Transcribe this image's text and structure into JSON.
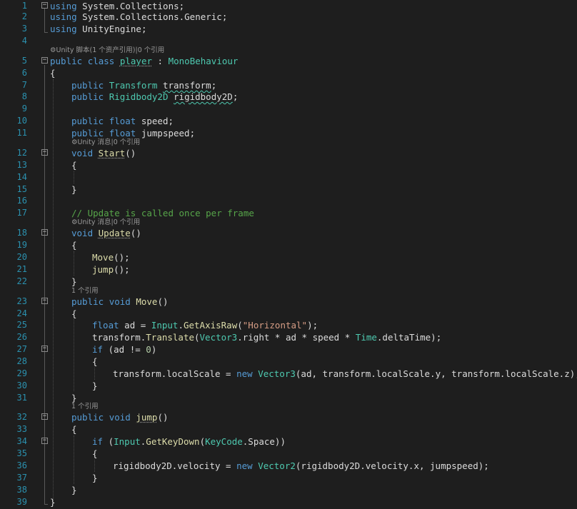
{
  "editor": {
    "line_numbers": [
      "1",
      "2",
      "3",
      "4",
      "5",
      "6",
      "7",
      "8",
      "9",
      "10",
      "11",
      "12",
      "13",
      "14",
      "15",
      "16",
      "17",
      "18",
      "19",
      "20",
      "21",
      "22",
      "23",
      "24",
      "25",
      "26",
      "27",
      "28",
      "29",
      "30",
      "31",
      "32",
      "33",
      "34",
      "35",
      "36",
      "37",
      "38",
      "39"
    ],
    "codelens": {
      "unity_script": "Unity 脚本(1 个资产引用)|0 个引用",
      "unity_message_start": "Unity 消息|0 个引用",
      "unity_message_update": "Unity 消息|0 个引用",
      "move_refs": "1 个引用",
      "jump_refs": "1 个引用"
    }
  },
  "code": {
    "l1": [
      "using",
      " System.Collections;"
    ],
    "l2": [
      "using",
      " System.Collections.Generic;"
    ],
    "l3": [
      "using",
      " UnityEngine;"
    ],
    "l5": [
      "public",
      " ",
      "class",
      " ",
      "player",
      " : ",
      "MonoBehaviour"
    ],
    "l6": [
      "{"
    ],
    "l7": [
      "public",
      " ",
      "Transform",
      " ",
      "transform",
      ";"
    ],
    "l8": [
      "public",
      " ",
      "Rigidbody2D",
      " ",
      "rigidbody2D",
      ";"
    ],
    "l10": [
      "public",
      " ",
      "float",
      " speed;"
    ],
    "l11": [
      "public",
      " ",
      "float",
      " jumpspeed;"
    ],
    "l12": [
      "void",
      " ",
      "Start",
      "()"
    ],
    "l13": [
      "{"
    ],
    "l15": [
      "}"
    ],
    "l17": [
      "// Update is called once per frame"
    ],
    "l18": [
      "void",
      " ",
      "Update",
      "()"
    ],
    "l19": [
      "{"
    ],
    "l20": [
      "Move",
      "();"
    ],
    "l21": [
      "jump",
      "();"
    ],
    "l22": [
      "}"
    ],
    "l23": [
      "public",
      " ",
      "void",
      " ",
      "Move",
      "()"
    ],
    "l24": [
      "{"
    ],
    "l25": [
      "float",
      " ad = ",
      "Input",
      ".",
      "GetAxisRaw",
      "(",
      "\"Horizontal\"",
      ");"
    ],
    "l26": [
      "transform",
      ".",
      "Translate",
      "(",
      "Vector3",
      ".right * ad * speed * ",
      "Time",
      ".deltaTime);"
    ],
    "l27": [
      "if",
      " (ad != ",
      "0",
      ")"
    ],
    "l28": [
      "{"
    ],
    "l29": [
      "transform",
      ".localScale = ",
      "new",
      " ",
      "Vector3",
      "(ad, ",
      "transform",
      ".localScale.y, ",
      "transform",
      ".localScale.z);"
    ],
    "l30": [
      "}"
    ],
    "l31": [
      "}"
    ],
    "l32": [
      "public",
      " ",
      "void",
      " ",
      "jump",
      "()"
    ],
    "l33": [
      "{"
    ],
    "l34": [
      "if",
      " (",
      "Input",
      ".",
      "GetKeyDown",
      "(",
      "KeyCode",
      ".Space))"
    ],
    "l35": [
      "{"
    ],
    "l36": [
      "rigidbody2D.velocity = ",
      "new",
      " ",
      "Vector2",
      "(rigidbody2D.velocity.x, jumpspeed);"
    ],
    "l37": [
      "}"
    ],
    "l38": [
      "}"
    ],
    "l39": [
      "}"
    ]
  },
  "icons": {
    "fold": "collapse-minus-icon",
    "unity": "unity-logo-icon"
  }
}
